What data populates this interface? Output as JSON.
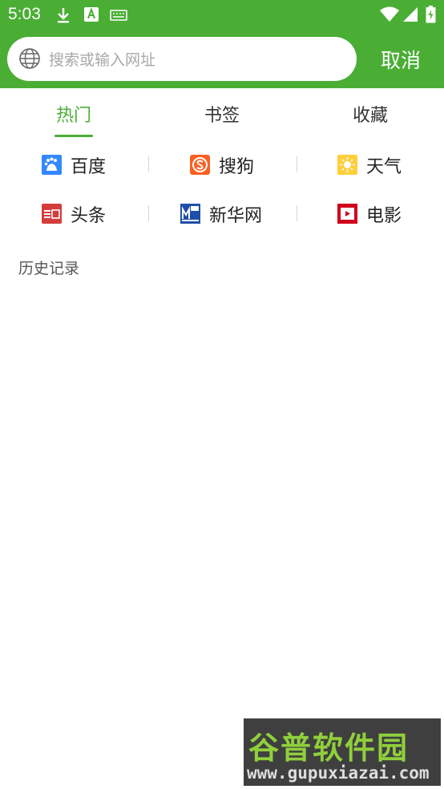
{
  "status_bar": {
    "time": "5:03",
    "icons": [
      "download-icon",
      "a-app-icon",
      "keyboard-icon",
      "wifi-icon",
      "signal-icon",
      "battery-icon"
    ]
  },
  "search": {
    "placeholder": "搜索或输入网址",
    "cancel_label": "取消"
  },
  "tabs": [
    {
      "label": "热门",
      "active": true
    },
    {
      "label": "书签",
      "active": false
    },
    {
      "label": "收藏",
      "active": false
    }
  ],
  "quick_links": [
    {
      "label": "百度",
      "icon": "baidu-icon",
      "color": "#3388ff"
    },
    {
      "label": "搜狗",
      "icon": "sogou-icon",
      "color": "#fb6022"
    },
    {
      "label": "天气",
      "icon": "weather-sun-icon",
      "color": "#ffcf3a"
    },
    {
      "label": "头条",
      "icon": "toutiao-news-icon",
      "color": "#d43d3d"
    },
    {
      "label": "新华网",
      "icon": "xinhua-icon",
      "color": "#1f4fa8"
    },
    {
      "label": "电影",
      "icon": "movie-play-icon",
      "color": "#d0021b"
    }
  ],
  "history": {
    "title": "历史记录"
  },
  "watermark": {
    "title": "谷普软件园",
    "url": "www.gupuxiazai.com"
  },
  "colors": {
    "accent": "#4aae35",
    "watermark_bg": "#3f3f3f",
    "watermark_green": "#8fcf3c"
  }
}
